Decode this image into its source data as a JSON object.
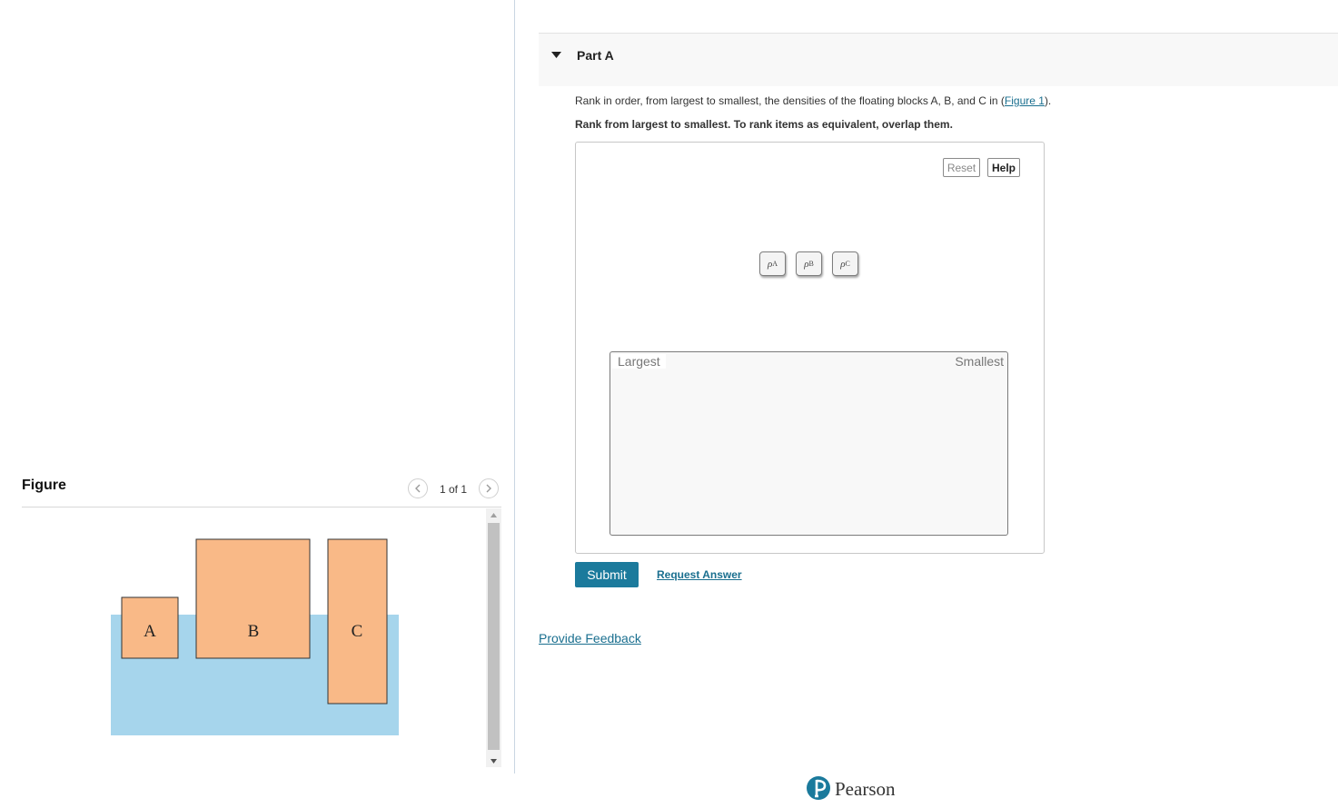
{
  "figure": {
    "title": "Figure",
    "pager_text": "1 of 1",
    "blocks": [
      "A",
      "B",
      "C"
    ],
    "colors": {
      "water": "#a6d5ec",
      "block": "#f9b987"
    }
  },
  "part": {
    "title": "Part A",
    "question_prefix": "Rank in order, from largest to smallest, the densities of the floating blocks A, B, and C in (",
    "figure_link": "Figure 1",
    "question_suffix": ").",
    "instruction": "Rank from largest to smallest. To rank items as equivalent, overlap them.",
    "reset_label": "Reset",
    "help_label": "Help",
    "tiles": [
      {
        "symbol": "ρ",
        "sub": "A"
      },
      {
        "symbol": "ρ",
        "sub": "B"
      },
      {
        "symbol": "ρ",
        "sub": "C"
      }
    ],
    "drop_left_label": "Largest",
    "drop_right_label": "Smallest",
    "submit_label": "Submit",
    "request_answer_label": "Request Answer"
  },
  "feedback_label": "Provide Feedback",
  "brand": {
    "name": "Pearson",
    "color": "#1b7a9c"
  }
}
